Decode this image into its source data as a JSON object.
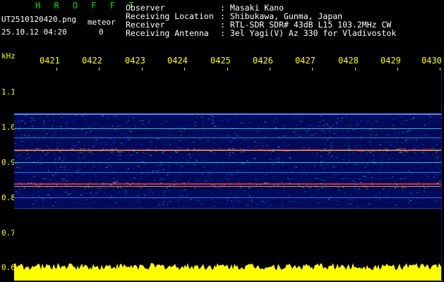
{
  "header": {
    "brand": "H R O F F T",
    "file_name": "UT2510120420.png",
    "meteor_label": "meteor",
    "datetime": "25.10.12 04:20",
    "meteor_count": "0",
    "fields": [
      {
        "label": "Observer",
        "value": ": Masaki Kano"
      },
      {
        "label": "Receiving Location",
        "value": ": Shibukawa, Gunma, Japan"
      },
      {
        "label": "Receiver",
        "value": ": RTL-SDR SDR# 43dB L15 103.2MHz CW"
      },
      {
        "label": "Receiving Antenna",
        "value": ": 3el Yagi(V) Az 330 for Vladivostok"
      }
    ]
  },
  "spectrogram": {
    "y_unit": "kHz",
    "y_ticks": [
      "1.1",
      "1.0",
      "0.9",
      "0.8",
      "0.7",
      "0.6"
    ],
    "x_ticks": [
      "0421",
      "0422",
      "0423",
      "0424",
      "0425",
      "0426",
      "0427",
      "0428",
      "0429",
      "0430"
    ],
    "colors": {
      "axis": "#ffff00",
      "brand": "#00e000",
      "text": "#ffffff",
      "background": "#000000"
    }
  }
}
